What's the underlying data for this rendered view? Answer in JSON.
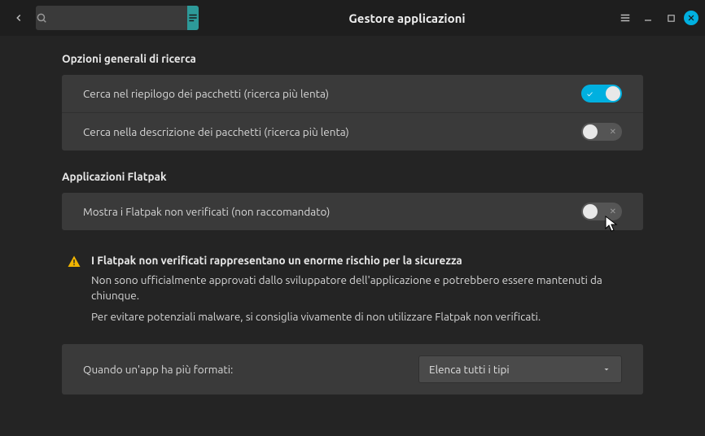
{
  "titlebar": {
    "title": "Gestore applicazioni"
  },
  "search": {
    "placeholder": ""
  },
  "sections": {
    "search_opts": {
      "title": "Opzioni generali di ricerca",
      "row1": "Cerca nel riepilogo dei pacchetti (ricerca più lenta)",
      "row2": "Cerca nella descrizione dei pacchetti (ricerca più lenta)"
    },
    "flatpak": {
      "title": "Applicazioni Flatpak",
      "row1": "Mostra i Flatpak non verificati (non raccomandato)",
      "warning": {
        "title": "I Flatpak non verificati rappresentano un enorme rischio per la sicurezza",
        "p1": "Non sono ufficialmente approvati dallo sviluppatore dell'applicazione e potrebbero esse­re mantenuti da chiunque.",
        "p2": "Per evitare potenziali malware, si consiglia vivamente di non utilizzare Flatpak non verifi­cati."
      },
      "format_label": "Quando un'app ha più formati:",
      "format_value": "Elenca tutti i tipi"
    }
  }
}
